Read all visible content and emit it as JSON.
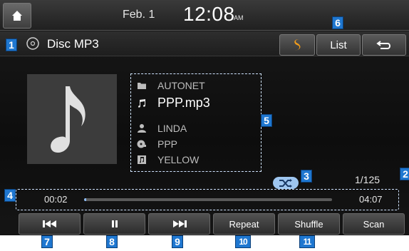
{
  "status_bar": {
    "date": "Feb.  1",
    "time": "12:08",
    "ampm": "AM"
  },
  "title_bar": {
    "source": "Disc MP3",
    "list_label": "List"
  },
  "track": {
    "folder": "AUTONET",
    "file": "PPP.mp3",
    "artist": "LINDA",
    "album": "PPP",
    "title": "YELLOW",
    "counter": "1/125"
  },
  "playback": {
    "elapsed": "00:02",
    "total": "04:07",
    "progress_fraction": 0.008
  },
  "controls": [
    {
      "label": "",
      "icon": "previous-track-icon"
    },
    {
      "label": "",
      "icon": "pause-icon"
    },
    {
      "label": "",
      "icon": "next-track-icon"
    },
    {
      "label": "Repeat"
    },
    {
      "label": "Shuffle"
    },
    {
      "label": "Scan"
    }
  ],
  "callouts": [
    "1",
    "2",
    "3",
    "4",
    "5",
    "6",
    "7",
    "8",
    "9",
    "10",
    "11"
  ],
  "colors": {
    "accent": "#1f77d0",
    "highlight": "#8ab8f0",
    "sound_effect_icon": "#f39c1a"
  }
}
